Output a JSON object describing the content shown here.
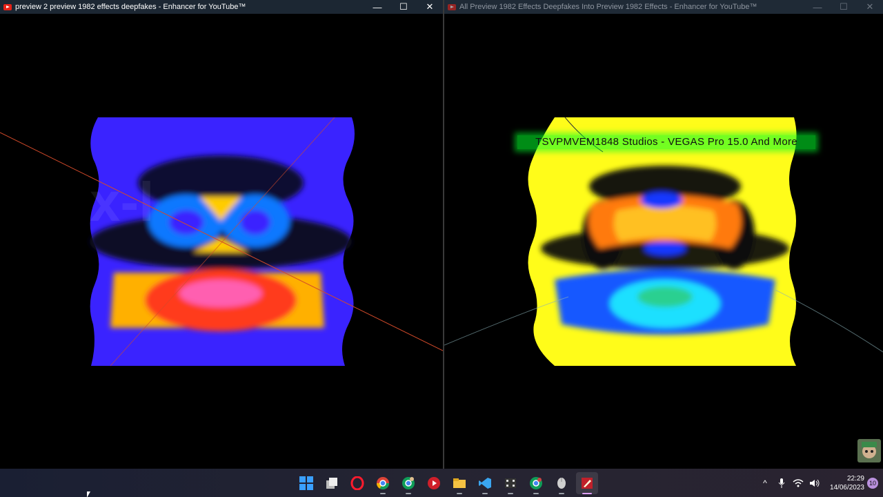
{
  "left_window": {
    "title": "preview 2 preview 1982 effects deepfakes - Enhancer for YouTube™",
    "minimize_glyph": "—",
    "maximize_glyph": "☐",
    "close_glyph": "✕"
  },
  "right_window": {
    "title": "All Preview 1982 Effects Deepfakes Into Preview 1982 Effects - Enhancer for YouTube™",
    "overlay_text": "TSVPMVEM1848 Studios - VEGAS Pro 15.0 And More",
    "minimize_glyph": "—",
    "maximize_glyph": "☐",
    "close_glyph": "✕"
  },
  "taskbar": {
    "apps": [
      "windows-start",
      "task-view",
      "opera",
      "chrome",
      "chrome-profile",
      "media-player",
      "file-explorer",
      "vscode",
      "video-editor",
      "chrome-2",
      "mouse-app",
      "pencil-app"
    ],
    "tray": {
      "chevron": "^",
      "time": "22:29",
      "date": "14/06/2023",
      "notification_count": "10"
    }
  },
  "colors": {
    "left_bg": "#3a23ff",
    "right_bg": "#fffc1a",
    "accent": "#e0a0ff"
  }
}
